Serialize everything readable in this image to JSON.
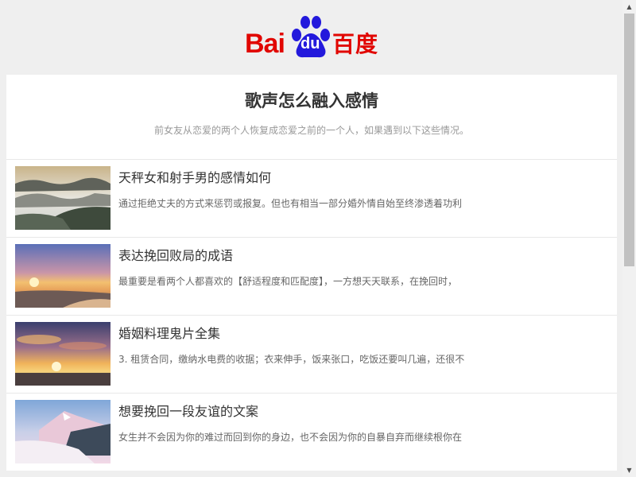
{
  "logo": {
    "latin": "Bai",
    "paw_text": "du",
    "chinese": "百度"
  },
  "header": {
    "title": "歌声怎么融入感情",
    "subtitle": "前女友从恋爱的两个人恢复成恋爱之前的一个人，如果遇到以下这些情况。"
  },
  "articles": [
    {
      "title": "天秤女和射手男的感情如何",
      "desc": "通过拒绝丈夫的方式来惩罚或报复。但也有相当一部分婚外情自始至终渗透着功利",
      "thumb": "misty-mountain-photo"
    },
    {
      "title": "表达挽回败局的成语",
      "desc": "最重要是看两个人都喜欢的【舒适程度和匹配度】，一方想天天联系，在挽回时，",
      "thumb": "beach-sunset-photo"
    },
    {
      "title": "婚姻料理鬼片全集",
      "desc": "3. 租赁合同，缴纳水电费的收据；衣来伸手，饭来张口，吃饭还要叫几遍，还很不",
      "thumb": "sunset-clouds-photo"
    },
    {
      "title": "想要挽回一段友谊的文案",
      "desc": "女生并不会因为你的难过而回到你的身边，也不会因为你的自暴自弃而继续根你在",
      "thumb": "snowy-mountain-photo"
    }
  ],
  "scrollbar": {
    "up_glyph": "▲",
    "down_glyph": "▼"
  },
  "colors": {
    "brand_red": "#e10601",
    "brand_blue": "#2319dc",
    "page_bg": "#efefef"
  }
}
